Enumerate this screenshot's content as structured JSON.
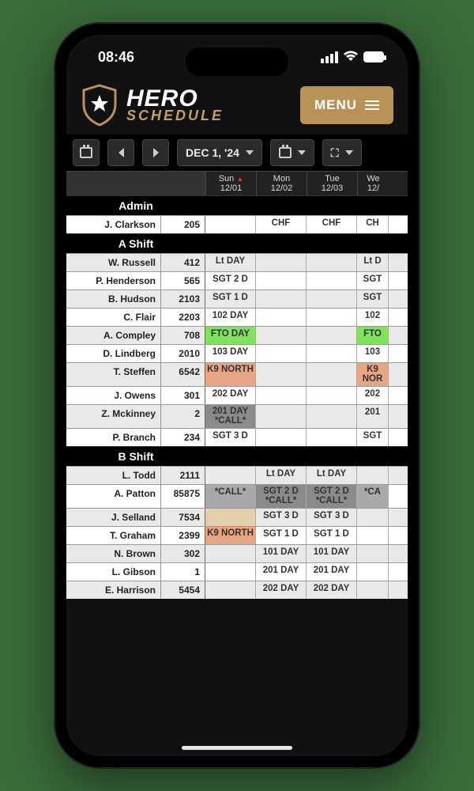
{
  "status": {
    "time": "08:46"
  },
  "brand": {
    "top": "HERO",
    "bottom": "SCHEDULE"
  },
  "menu": {
    "label": "MENU"
  },
  "toolbar": {
    "date_label": "DEC 1, '24"
  },
  "dates": [
    {
      "dow": "Sun",
      "md": "12/01",
      "alert": true
    },
    {
      "dow": "Mon",
      "md": "12/02",
      "alert": false
    },
    {
      "dow": "Tue",
      "md": "12/03",
      "alert": false
    },
    {
      "dow": "We",
      "md": "12/",
      "alert": false
    }
  ],
  "sections": [
    {
      "title": "Admin",
      "rows": [
        {
          "name": "J. Clarkson",
          "id": "205",
          "cells": [
            {
              "text": ""
            },
            {
              "text": "CHF"
            },
            {
              "text": "CHF"
            },
            {
              "text": "CH"
            }
          ]
        }
      ]
    },
    {
      "title": "A Shift",
      "rows": [
        {
          "name": "W. Russell",
          "id": "412",
          "cells": [
            {
              "text": "Lt DAY"
            },
            {
              "text": ""
            },
            {
              "text": ""
            },
            {
              "text": "Lt D"
            }
          ]
        },
        {
          "name": "P. Henderson",
          "id": "565",
          "cells": [
            {
              "text": "SGT 2 D"
            },
            {
              "text": ""
            },
            {
              "text": ""
            },
            {
              "text": "SGT"
            }
          ]
        },
        {
          "name": "B. Hudson",
          "id": "2103",
          "cells": [
            {
              "text": "SGT 1 D"
            },
            {
              "text": ""
            },
            {
              "text": ""
            },
            {
              "text": "SGT"
            }
          ]
        },
        {
          "name": "C. Flair",
          "id": "2203",
          "cells": [
            {
              "text": "102 DAY"
            },
            {
              "text": ""
            },
            {
              "text": ""
            },
            {
              "text": "102"
            }
          ]
        },
        {
          "name": "A. Compley",
          "id": "708",
          "cells": [
            {
              "text": "FTO DAY",
              "cls": "c-green"
            },
            {
              "text": ""
            },
            {
              "text": ""
            },
            {
              "text": "FTO",
              "cls": "c-green"
            }
          ]
        },
        {
          "name": "D. Lindberg",
          "id": "2010",
          "cells": [
            {
              "text": "103 DAY"
            },
            {
              "text": ""
            },
            {
              "text": ""
            },
            {
              "text": "103"
            }
          ]
        },
        {
          "name": "T. Steffen",
          "id": "6542",
          "cells": [
            {
              "text": "K9 NORTH",
              "cls": "c-salmon two-line"
            },
            {
              "text": ""
            },
            {
              "text": ""
            },
            {
              "text": "K9 NOR",
              "cls": "c-salmon two-line"
            }
          ]
        },
        {
          "name": "J. Owens",
          "id": "301",
          "cells": [
            {
              "text": "202 DAY"
            },
            {
              "text": ""
            },
            {
              "text": ""
            },
            {
              "text": "202"
            }
          ]
        },
        {
          "name": "Z. Mckinney",
          "id": "2",
          "cells": [
            {
              "text": "201 DAY *CALL*",
              "cls": "c-gray two-line"
            },
            {
              "text": ""
            },
            {
              "text": ""
            },
            {
              "text": "201"
            }
          ]
        },
        {
          "name": "P. Branch",
          "id": "234",
          "cells": [
            {
              "text": "SGT 3 D"
            },
            {
              "text": ""
            },
            {
              "text": ""
            },
            {
              "text": "SGT"
            }
          ]
        }
      ]
    },
    {
      "title": "B Shift",
      "rows": [
        {
          "name": "L. Todd",
          "id": "2111",
          "cells": [
            {
              "text": ""
            },
            {
              "text": "Lt DAY"
            },
            {
              "text": "Lt DAY"
            },
            {
              "text": ""
            }
          ]
        },
        {
          "name": "A. Patton",
          "id": "85875",
          "cells": [
            {
              "text": "*CALL*",
              "cls": "c-callgray"
            },
            {
              "text": "SGT 2 D *CALL*",
              "cls": "c-gray two-line"
            },
            {
              "text": "SGT 2 D *CALL*",
              "cls": "c-gray two-line"
            },
            {
              "text": "*CA",
              "cls": "c-callgray"
            }
          ]
        },
        {
          "name": "J. Selland",
          "id": "7534",
          "cells": [
            {
              "text": "",
              "cls": "c-beige"
            },
            {
              "text": "SGT 3 D"
            },
            {
              "text": "SGT 3 D"
            },
            {
              "text": ""
            }
          ]
        },
        {
          "name": "T. Graham",
          "id": "2399",
          "cells": [
            {
              "text": "K9 NORTH",
              "cls": "c-salmon two-line"
            },
            {
              "text": "SGT 1 D"
            },
            {
              "text": "SGT 1 D"
            },
            {
              "text": ""
            }
          ]
        },
        {
          "name": "N. Brown",
          "id": "302",
          "cells": [
            {
              "text": ""
            },
            {
              "text": "101 DAY"
            },
            {
              "text": "101 DAY"
            },
            {
              "text": ""
            }
          ]
        },
        {
          "name": "L. Gibson",
          "id": "1",
          "cells": [
            {
              "text": ""
            },
            {
              "text": "201 DAY"
            },
            {
              "text": "201 DAY"
            },
            {
              "text": ""
            }
          ]
        },
        {
          "name": "E. Harrison",
          "id": "5454",
          "cells": [
            {
              "text": ""
            },
            {
              "text": "202 DAY"
            },
            {
              "text": "202 DAY"
            },
            {
              "text": ""
            }
          ]
        }
      ]
    }
  ]
}
